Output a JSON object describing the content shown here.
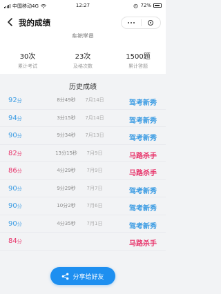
{
  "status_bar": {
    "carrier": "中国移动4G",
    "time": "12:27",
    "battery": "72%"
  },
  "nav": {
    "title": "我的成绩"
  },
  "stats": {
    "cut_text": "车祀学员",
    "items": [
      {
        "value": "30次",
        "label": "累计考试"
      },
      {
        "value": "23次",
        "label": "及格次数"
      },
      {
        "value": "1500题",
        "label": "累计答题"
      }
    ]
  },
  "history": {
    "title": "历史成绩",
    "unit": "分",
    "rows": [
      {
        "score": "92",
        "duration": "8分49秒",
        "date": "7月14日",
        "badge": "驾考新秀",
        "color": "#3a9be3"
      },
      {
        "score": "94",
        "duration": "3分15秒",
        "date": "7月14日",
        "badge": "驾考新秀",
        "color": "#3a9be3"
      },
      {
        "score": "90",
        "duration": "9分34秒",
        "date": "7月13日",
        "badge": "驾考新秀",
        "color": "#3a9be3"
      },
      {
        "score": "82",
        "duration": "13分15秒",
        "date": "7月9日",
        "badge": "马路杀手",
        "color": "#e8336a"
      },
      {
        "score": "86",
        "duration": "4分29秒",
        "date": "7月9日",
        "badge": "马路杀手",
        "color": "#e8336a"
      },
      {
        "score": "90",
        "duration": "9分29秒",
        "date": "7月7日",
        "badge": "驾考新秀",
        "color": "#3a9be3"
      },
      {
        "score": "90",
        "duration": "10分2秒",
        "date": "7月6日",
        "badge": "驾考新秀",
        "color": "#3a9be3"
      },
      {
        "score": "90",
        "duration": "4分35秒",
        "date": "7月1日",
        "badge": "驾考新秀",
        "color": "#3a9be3"
      },
      {
        "score": "84",
        "duration": "",
        "date": "",
        "badge": "马路杀手",
        "color": "#e8336a"
      }
    ]
  },
  "share_button": {
    "label": "分享给好友",
    "icon": "share-icon"
  }
}
